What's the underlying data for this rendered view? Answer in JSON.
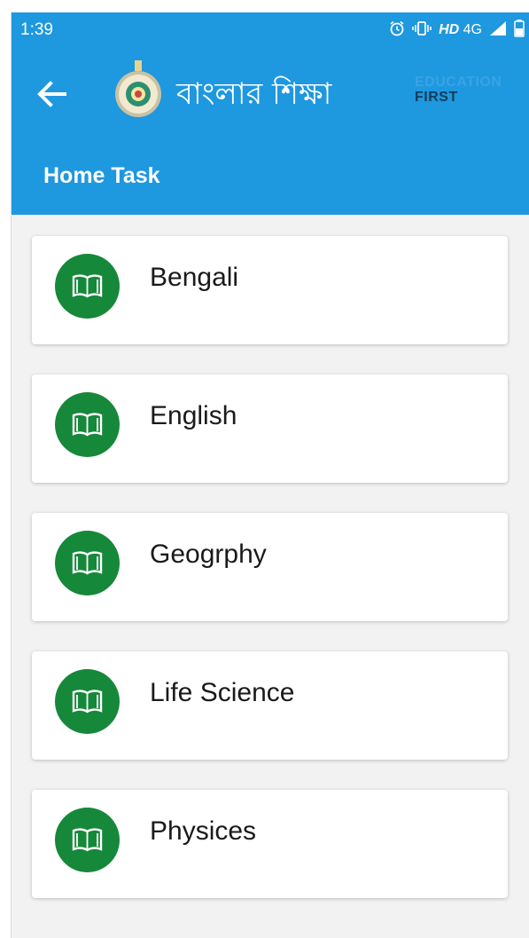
{
  "status_bar": {
    "time": "1:39",
    "network_hd": "HD",
    "network_type": "4G"
  },
  "app_bar": {
    "title_bengali": "বাংলার শিক্ষা",
    "brand_line1": "EDUCATION",
    "brand_line2": "FIRST",
    "page_title": "Home Task",
    "accent_color": "#1e98df"
  },
  "subjects": [
    {
      "label": "Bengali",
      "icon": "book-icon"
    },
    {
      "label": "English",
      "icon": "book-icon"
    },
    {
      "label": "Geogrphy",
      "icon": "book-icon"
    },
    {
      "label": "Life Science",
      "icon": "book-icon"
    },
    {
      "label": "Physices",
      "icon": "book-icon"
    }
  ],
  "icon_color": "#16883a"
}
